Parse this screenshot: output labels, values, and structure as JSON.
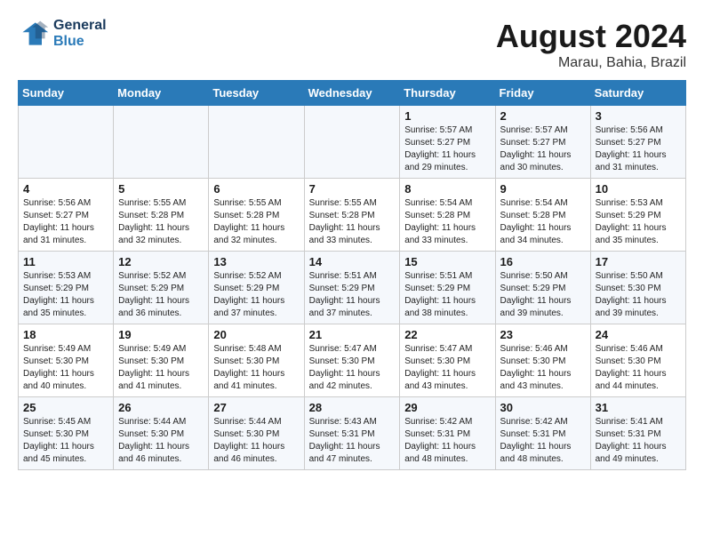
{
  "header": {
    "logo_line1": "General",
    "logo_line2": "Blue",
    "month": "August 2024",
    "location": "Marau, Bahia, Brazil"
  },
  "days_of_week": [
    "Sunday",
    "Monday",
    "Tuesday",
    "Wednesday",
    "Thursday",
    "Friday",
    "Saturday"
  ],
  "weeks": [
    [
      {
        "day": "",
        "info": ""
      },
      {
        "day": "",
        "info": ""
      },
      {
        "day": "",
        "info": ""
      },
      {
        "day": "",
        "info": ""
      },
      {
        "day": "1",
        "info": "Sunrise: 5:57 AM\nSunset: 5:27 PM\nDaylight: 11 hours\nand 29 minutes."
      },
      {
        "day": "2",
        "info": "Sunrise: 5:57 AM\nSunset: 5:27 PM\nDaylight: 11 hours\nand 30 minutes."
      },
      {
        "day": "3",
        "info": "Sunrise: 5:56 AM\nSunset: 5:27 PM\nDaylight: 11 hours\nand 31 minutes."
      }
    ],
    [
      {
        "day": "4",
        "info": "Sunrise: 5:56 AM\nSunset: 5:27 PM\nDaylight: 11 hours\nand 31 minutes."
      },
      {
        "day": "5",
        "info": "Sunrise: 5:55 AM\nSunset: 5:28 PM\nDaylight: 11 hours\nand 32 minutes."
      },
      {
        "day": "6",
        "info": "Sunrise: 5:55 AM\nSunset: 5:28 PM\nDaylight: 11 hours\nand 32 minutes."
      },
      {
        "day": "7",
        "info": "Sunrise: 5:55 AM\nSunset: 5:28 PM\nDaylight: 11 hours\nand 33 minutes."
      },
      {
        "day": "8",
        "info": "Sunrise: 5:54 AM\nSunset: 5:28 PM\nDaylight: 11 hours\nand 33 minutes."
      },
      {
        "day": "9",
        "info": "Sunrise: 5:54 AM\nSunset: 5:28 PM\nDaylight: 11 hours\nand 34 minutes."
      },
      {
        "day": "10",
        "info": "Sunrise: 5:53 AM\nSunset: 5:29 PM\nDaylight: 11 hours\nand 35 minutes."
      }
    ],
    [
      {
        "day": "11",
        "info": "Sunrise: 5:53 AM\nSunset: 5:29 PM\nDaylight: 11 hours\nand 35 minutes."
      },
      {
        "day": "12",
        "info": "Sunrise: 5:52 AM\nSunset: 5:29 PM\nDaylight: 11 hours\nand 36 minutes."
      },
      {
        "day": "13",
        "info": "Sunrise: 5:52 AM\nSunset: 5:29 PM\nDaylight: 11 hours\nand 37 minutes."
      },
      {
        "day": "14",
        "info": "Sunrise: 5:51 AM\nSunset: 5:29 PM\nDaylight: 11 hours\nand 37 minutes."
      },
      {
        "day": "15",
        "info": "Sunrise: 5:51 AM\nSunset: 5:29 PM\nDaylight: 11 hours\nand 38 minutes."
      },
      {
        "day": "16",
        "info": "Sunrise: 5:50 AM\nSunset: 5:29 PM\nDaylight: 11 hours\nand 39 minutes."
      },
      {
        "day": "17",
        "info": "Sunrise: 5:50 AM\nSunset: 5:30 PM\nDaylight: 11 hours\nand 39 minutes."
      }
    ],
    [
      {
        "day": "18",
        "info": "Sunrise: 5:49 AM\nSunset: 5:30 PM\nDaylight: 11 hours\nand 40 minutes."
      },
      {
        "day": "19",
        "info": "Sunrise: 5:49 AM\nSunset: 5:30 PM\nDaylight: 11 hours\nand 41 minutes."
      },
      {
        "day": "20",
        "info": "Sunrise: 5:48 AM\nSunset: 5:30 PM\nDaylight: 11 hours\nand 41 minutes."
      },
      {
        "day": "21",
        "info": "Sunrise: 5:47 AM\nSunset: 5:30 PM\nDaylight: 11 hours\nand 42 minutes."
      },
      {
        "day": "22",
        "info": "Sunrise: 5:47 AM\nSunset: 5:30 PM\nDaylight: 11 hours\nand 43 minutes."
      },
      {
        "day": "23",
        "info": "Sunrise: 5:46 AM\nSunset: 5:30 PM\nDaylight: 11 hours\nand 43 minutes."
      },
      {
        "day": "24",
        "info": "Sunrise: 5:46 AM\nSunset: 5:30 PM\nDaylight: 11 hours\nand 44 minutes."
      }
    ],
    [
      {
        "day": "25",
        "info": "Sunrise: 5:45 AM\nSunset: 5:30 PM\nDaylight: 11 hours\nand 45 minutes."
      },
      {
        "day": "26",
        "info": "Sunrise: 5:44 AM\nSunset: 5:30 PM\nDaylight: 11 hours\nand 46 minutes."
      },
      {
        "day": "27",
        "info": "Sunrise: 5:44 AM\nSunset: 5:30 PM\nDaylight: 11 hours\nand 46 minutes."
      },
      {
        "day": "28",
        "info": "Sunrise: 5:43 AM\nSunset: 5:31 PM\nDaylight: 11 hours\nand 47 minutes."
      },
      {
        "day": "29",
        "info": "Sunrise: 5:42 AM\nSunset: 5:31 PM\nDaylight: 11 hours\nand 48 minutes."
      },
      {
        "day": "30",
        "info": "Sunrise: 5:42 AM\nSunset: 5:31 PM\nDaylight: 11 hours\nand 48 minutes."
      },
      {
        "day": "31",
        "info": "Sunrise: 5:41 AM\nSunset: 5:31 PM\nDaylight: 11 hours\nand 49 minutes."
      }
    ]
  ]
}
